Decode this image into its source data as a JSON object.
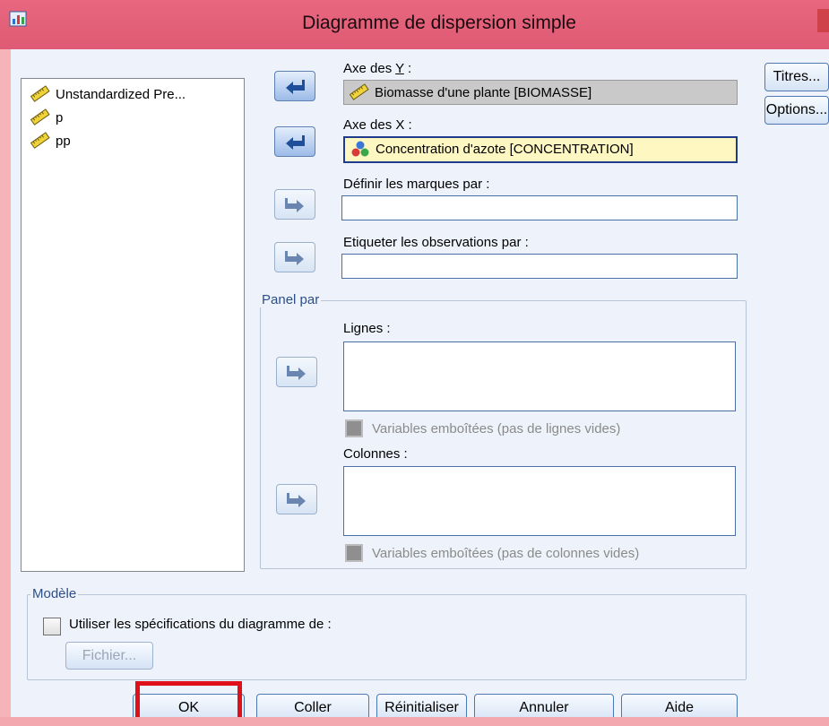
{
  "window": {
    "title": "Diagramme de dispersion simple"
  },
  "variables": [
    {
      "label": "Unstandardized Pre...",
      "icon": "scale-ruler-icon"
    },
    {
      "label": "p",
      "icon": "scale-ruler-icon"
    },
    {
      "label": "pp",
      "icon": "scale-ruler-icon"
    }
  ],
  "y_axis": {
    "label_pre": "Axe des ",
    "label_key": "Y",
    "label_post": " :",
    "value": "Biomasse d'une plante [BIOMASSE]",
    "icon": "scale-ruler-icon"
  },
  "x_axis": {
    "label_pre": "Axe des X :",
    "value": "Concentration d'azote [CONCENTRATION]",
    "icon": "nominal-variable-icon"
  },
  "markers": {
    "label": "Définir les marques par :",
    "value": ""
  },
  "labels_obs": {
    "label": "Etiqueter les observations par :",
    "value": ""
  },
  "panel": {
    "title": "Panel par",
    "rows_label": "Lignes :",
    "rows_nested": "Variables emboîtées (pas de lignes vides)",
    "cols_label": "Colonnes :",
    "cols_nested": "Variables emboîtées (pas de colonnes vides)"
  },
  "template": {
    "title": "Modèle",
    "use_spec_label": "Utiliser les spécifications du diagramme de :",
    "file_button": "Fichier..."
  },
  "side_buttons": {
    "titles": "Titres...",
    "options": "Options..."
  },
  "bottom_buttons": {
    "ok": "OK",
    "paste": "Coller",
    "reset": "Réinitialiser",
    "cancel": "Annuler",
    "help": "Aide"
  },
  "colors": {
    "title_bar": "#e8677f",
    "dialog_bg": "#eef3fb",
    "highlight": "#e0101a"
  }
}
